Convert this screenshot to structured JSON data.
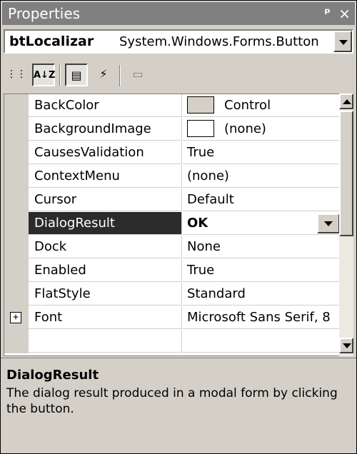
{
  "window": {
    "title": "Properties",
    "pin_glyph": "ᵖ",
    "close_glyph": "×"
  },
  "object_selector": {
    "name": "btLocalizar",
    "type": "System.Windows.Forms.Button"
  },
  "toolbar": {
    "categorized": "⋮⋮",
    "alphabetical": "A↓Z",
    "properties": "▤",
    "events": "⚡",
    "pages": "▭"
  },
  "grid": {
    "rows": [
      {
        "label": "BackColor",
        "value": "Control",
        "swatch": "#d4d0c8"
      },
      {
        "label": "BackgroundImage",
        "value": "(none)",
        "swatch": "#ffffff"
      },
      {
        "label": "CausesValidation",
        "value": "True"
      },
      {
        "label": "ContextMenu",
        "value": "(none)"
      },
      {
        "label": "Cursor",
        "value": "Default"
      },
      {
        "label": "DialogResult",
        "value": "OK",
        "selected": true
      },
      {
        "label": "Dock",
        "value": "None"
      },
      {
        "label": "Enabled",
        "value": "True"
      },
      {
        "label": "FlatStyle",
        "value": "Standard"
      },
      {
        "label": "Font",
        "value": "Microsoft Sans Serif, 8",
        "expandable": true,
        "expand_glyph": "+"
      }
    ]
  },
  "help": {
    "title": "DialogResult",
    "description": "The dialog result produced in a modal form by clicking the button."
  }
}
